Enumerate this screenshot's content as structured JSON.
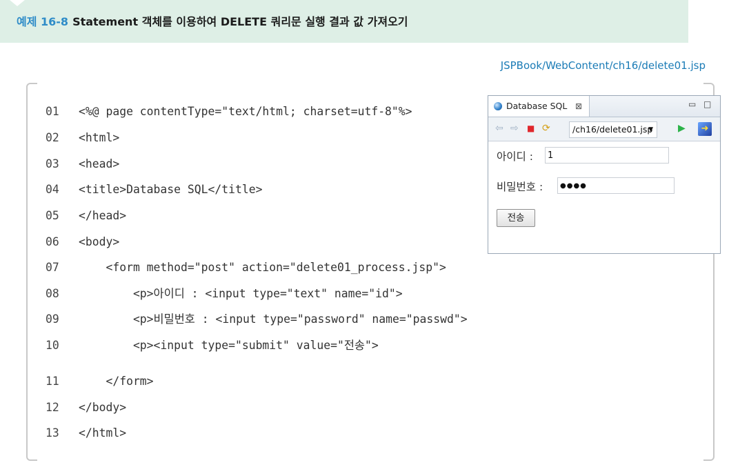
{
  "header": {
    "example_number": "예제 16-8",
    "title": "Statement 객체를 이용하여 DELETE 쿼리문 실행 결과 값 가져오기"
  },
  "file_path": "JSPBook/WebContent/ch16/delete01.jsp",
  "code": {
    "lines": [
      {
        "num": "01",
        "text": "<%@ page contentType=\"text/html; charset=utf-8\"%>"
      },
      {
        "num": "02",
        "text": "<html>"
      },
      {
        "num": "03",
        "text": "<head>"
      },
      {
        "num": "04",
        "text": "<title>Database SQL</title>"
      },
      {
        "num": "05",
        "text": "</head>"
      },
      {
        "num": "06",
        "text": "<body>"
      },
      {
        "num": "07",
        "text": "    <form method=\"post\" action=\"delete01_process.jsp\">"
      },
      {
        "num": "08",
        "text": "        <p>아이디 : <input type=\"text\" name=\"id\">"
      },
      {
        "num": "09",
        "text": "        <p>비밀번호 : <input type=\"password\" name=\"passwd\">"
      },
      {
        "num": "10",
        "text": "        <p><input type=\"submit\" value=\"전송\">"
      },
      {
        "num": "11",
        "text": "    </form>"
      },
      {
        "num": "12",
        "text": "</body>"
      },
      {
        "num": "13",
        "text": "</html>"
      }
    ]
  },
  "preview": {
    "tab_label": "Database SQL",
    "tab_close": "⊠",
    "minimize": "▭",
    "maximize": "□",
    "url": "/ch16/delete01.jsp",
    "id_label": "아이디 :",
    "id_value": "1",
    "password_label": "비밀번호 :",
    "password_value": "●●●●",
    "submit_label": "전송"
  },
  "colors": {
    "header_bg": "#deefe6",
    "example_number": "#2f8cc8",
    "file_path": "#1a7bb6"
  }
}
